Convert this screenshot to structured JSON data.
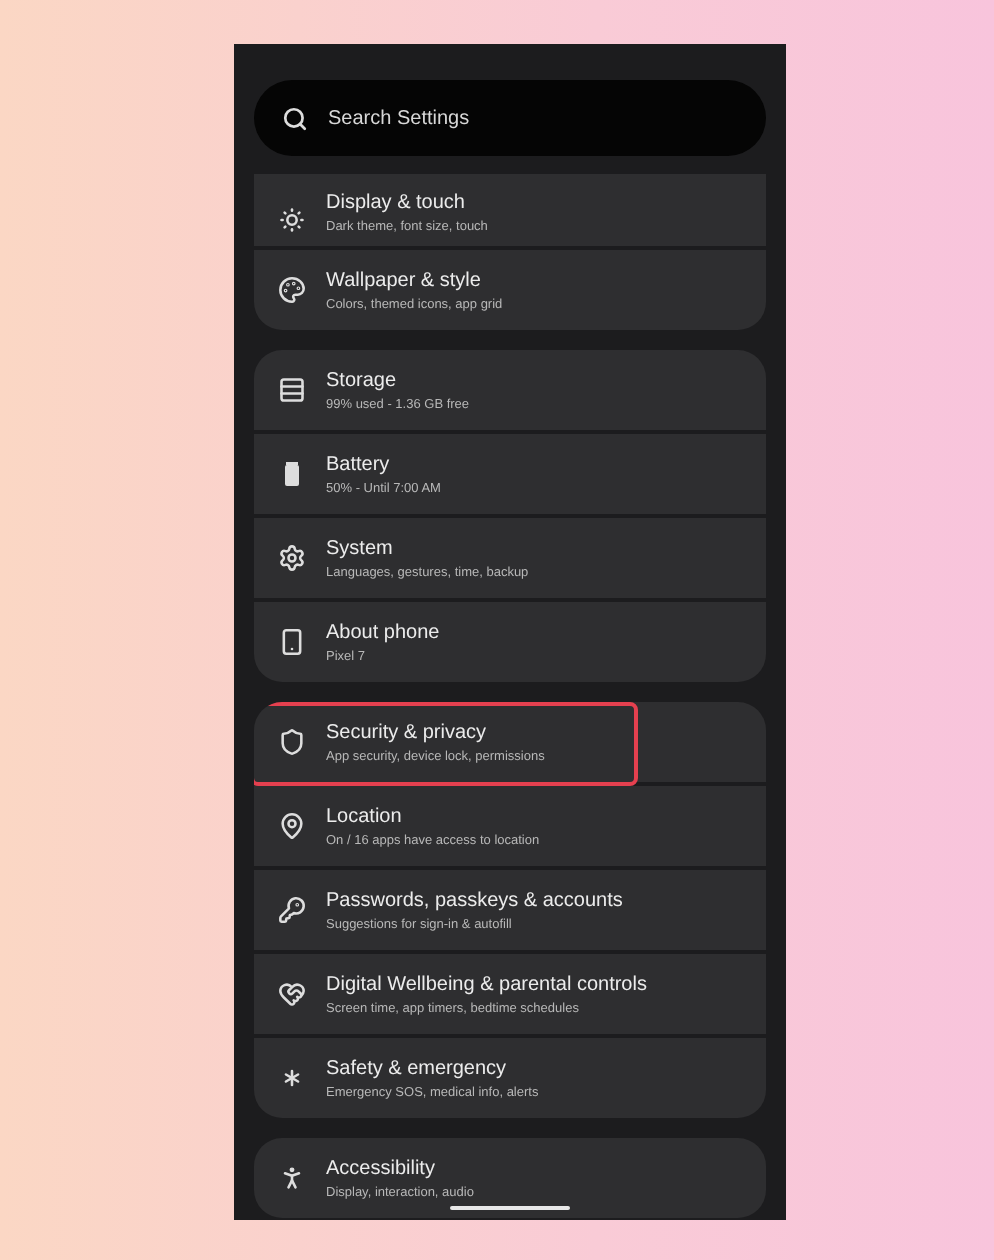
{
  "search": {
    "placeholder": "Search Settings"
  },
  "groups": [
    {
      "items": [
        {
          "title": "Display & touch",
          "subtitle": "Dark theme, font size, touch",
          "highlighted": false
        },
        {
          "title": "Wallpaper & style",
          "subtitle": "Colors, themed icons, app grid",
          "highlighted": false
        }
      ]
    },
    {
      "items": [
        {
          "title": "Storage",
          "subtitle": "99% used - 1.36 GB free",
          "highlighted": false
        },
        {
          "title": "Battery",
          "subtitle": "50% - Until 7:00 AM",
          "highlighted": false
        },
        {
          "title": "System",
          "subtitle": "Languages, gestures, time, backup",
          "highlighted": false
        },
        {
          "title": "About phone",
          "subtitle": "Pixel 7",
          "highlighted": false
        }
      ]
    },
    {
      "items": [
        {
          "title": "Security & privacy",
          "subtitle": "App security, device lock, permissions",
          "highlighted": true
        },
        {
          "title": "Location",
          "subtitle": "On / 16 apps have access to location",
          "highlighted": false
        },
        {
          "title": "Passwords, passkeys & accounts",
          "subtitle": "Suggestions for sign-in & autofill",
          "highlighted": false
        },
        {
          "title": "Digital Wellbeing & parental controls",
          "subtitle": "Screen time, app timers, bedtime schedules",
          "highlighted": false
        },
        {
          "title": "Safety & emergency",
          "subtitle": "Emergency SOS, medical info, alerts",
          "highlighted": false
        }
      ]
    },
    {
      "items": [
        {
          "title": "Accessibility",
          "subtitle": "Display, interaction, audio",
          "highlighted": false
        }
      ]
    }
  ]
}
